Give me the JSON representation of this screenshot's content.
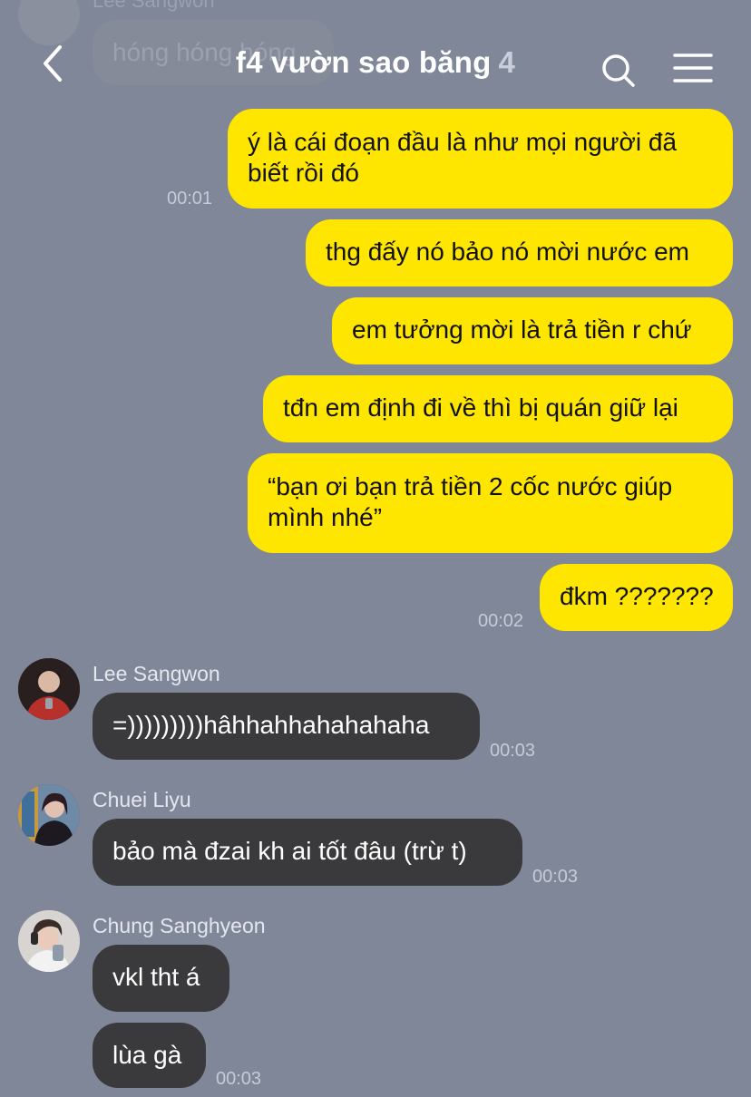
{
  "header": {
    "title": "f4 vườn sao băng",
    "member_count": "4"
  },
  "background_message": {
    "sender": "Lee Sangwon",
    "text": "hóng hóng hóng"
  },
  "outgoing": [
    {
      "text": "ý là cái đoạn đầu là như mọi người đã",
      "text2": "biết rồi đó",
      "time": "00:01"
    },
    {
      "text": "thg đấy nó bảo nó mời nước em"
    },
    {
      "text": "em tưởng mời là trả tiền r chứ"
    },
    {
      "text": "tđn em định đi về thì bị quán giữ lại"
    },
    {
      "text": "“bạn ơi bạn trả tiền 2 cốc nước giúp",
      "text2": "mình nhé”"
    },
    {
      "text": "đkm ???????",
      "time": "00:02"
    }
  ],
  "incoming": [
    {
      "sender": "Lee Sangwon",
      "text": "=)))))))))hâhhahhahahahaha",
      "time": "00:03",
      "avatar_color": "#3b2523"
    },
    {
      "sender": "Chuei Liyu",
      "text": "bảo mà đzai kh ai tốt đâu (trừ t)",
      "time": "00:03",
      "avatar_color": "#4a3b52"
    },
    {
      "sender": "Chung Sanghyeon",
      "text": "vkl tht á",
      "text2": "lùa gà",
      "time": "00:03",
      "avatar_color": "#c9c4c2"
    }
  ]
}
